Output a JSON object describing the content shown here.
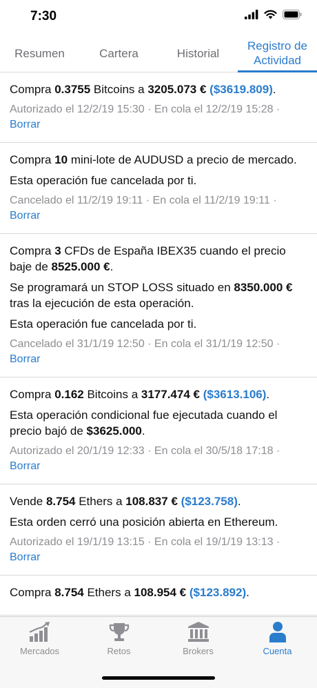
{
  "status": {
    "time": "7:30"
  },
  "tabs": [
    {
      "label": "Resumen"
    },
    {
      "label": "Cartera"
    },
    {
      "label": "Historial"
    },
    {
      "label": "Registro de Actividad"
    }
  ],
  "feed": [
    {
      "p1_a": "Compra ",
      "p1_b": "0.3755",
      "p1_c": " Bitcoins a ",
      "p1_d": "3205.073 €",
      "p1_e": " ",
      "p1_usd": "($3619.809)",
      "p1_f": ".",
      "meta": "Autorizado el 12/2/19 15:30 · En cola el 12/2/19 15:28 ·",
      "action": "Borrar"
    },
    {
      "p1_a": "Compra ",
      "p1_b": "10",
      "p1_c": " mini-lote de AUDUSD a precio de mercado.",
      "p2": "Esta operación fue cancelada por ti.",
      "meta": "Cancelado el 11/2/19 19:11 · En cola el 11/2/19 19:11 ·",
      "action": "Borrar"
    },
    {
      "p1_a": "Compra ",
      "p1_b": "3",
      "p1_c": " CFDs de España IBEX35 cuando el precio baje de ",
      "p1_d": "8525.000 €",
      "p1_e": ".",
      "p2_a": "Se programará un STOP LOSS situado en ",
      "p2_b": "8350.000 €",
      "p2_c": " tras la ejecución de esta operación.",
      "p3": "Esta operación fue cancelada por ti.",
      "meta": "Cancelado el 31/1/19 12:50 · En cola el 31/1/19 12:50 ·",
      "action": "Borrar"
    },
    {
      "p1_a": "Compra ",
      "p1_b": "0.162",
      "p1_c": " Bitcoins a ",
      "p1_d": "3177.474 €",
      "p1_e": " ",
      "p1_usd": "($3613.106)",
      "p1_f": ".",
      "p2_a": "Esta operación condicional fue ejecutada cuando el precio bajó de ",
      "p2_b": "$3625.000",
      "p2_c": ".",
      "meta": "Autorizado el 20/1/19 12:33 · En cola el 30/5/18 17:18 ·",
      "action": "Borrar"
    },
    {
      "p1_a": "Vende ",
      "p1_b": "8.754",
      "p1_c": " Ethers a ",
      "p1_d": "108.837 €",
      "p1_e": " ",
      "p1_usd": "($123.758)",
      "p1_f": ".",
      "p2": "Esta orden cerró una posición abierta en Ethereum.",
      "meta": "Autorizado el 19/1/19 13:15 · En cola el 19/1/19 13:13 ·",
      "action": "Borrar"
    },
    {
      "p1_a": "Compra ",
      "p1_b": "8.754",
      "p1_c": " Ethers a ",
      "p1_d": "108.954 €",
      "p1_e": " ",
      "p1_usd": "($123.892)",
      "p1_f": "."
    }
  ],
  "tabbar": [
    {
      "label": "Mercados",
      "icon": "chart-growth-icon"
    },
    {
      "label": "Retos",
      "icon": "trophy-icon"
    },
    {
      "label": "Brokers",
      "icon": "bank-icon"
    },
    {
      "label": "Cuenta",
      "icon": "user-icon"
    }
  ],
  "colors": {
    "accent": "#2a7ccd",
    "muted": "#8e8e93",
    "tab_inactive": "#6d6d72"
  }
}
